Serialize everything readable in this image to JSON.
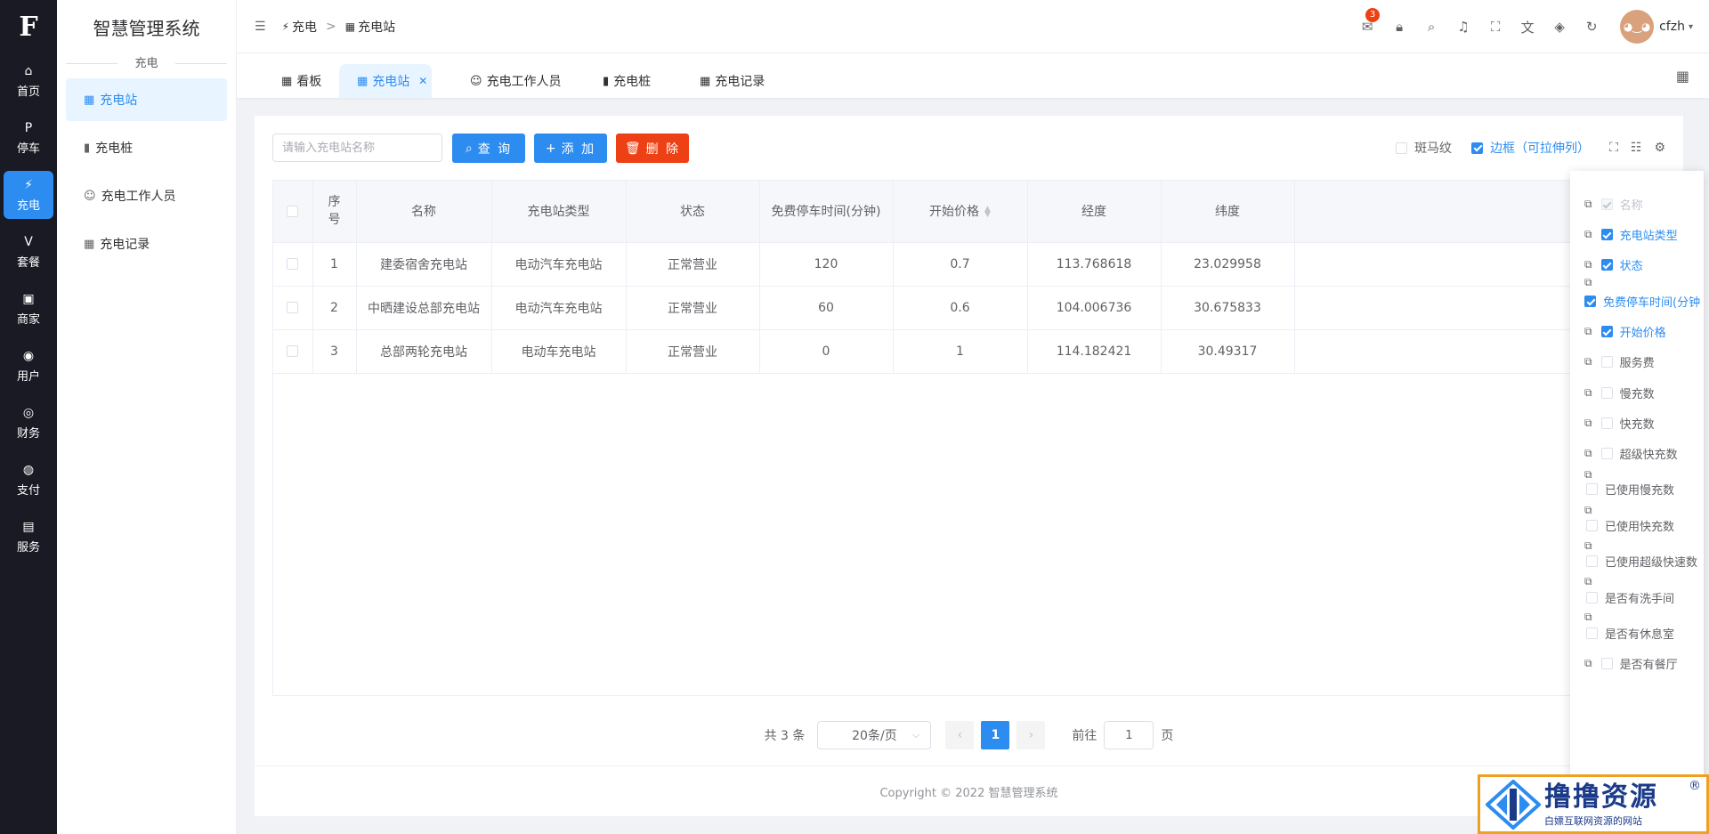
{
  "rail": {
    "logo": "F",
    "items": [
      {
        "label": "首页",
        "icon": "home-icon",
        "glyph": "⌂"
      },
      {
        "label": "停车",
        "icon": "parking-icon",
        "glyph": "P"
      },
      {
        "label": "充电",
        "icon": "charging-icon",
        "glyph": "⚡"
      },
      {
        "label": "套餐",
        "icon": "vip-icon",
        "glyph": "V"
      },
      {
        "label": "商家",
        "icon": "shop-icon",
        "glyph": "▣"
      },
      {
        "label": "用户",
        "icon": "user-icon",
        "glyph": "◉"
      },
      {
        "label": "财务",
        "icon": "finance-icon",
        "glyph": "◎"
      },
      {
        "label": "支付",
        "icon": "pay-icon",
        "glyph": "◍"
      },
      {
        "label": "服务",
        "icon": "service-icon",
        "glyph": "▤"
      }
    ],
    "active_index": 2
  },
  "sidebar": {
    "system_title": "智慧管理系统",
    "group_label": "充电",
    "items": [
      {
        "label": "充电站",
        "icon": "grid-icon",
        "glyph": "▦"
      },
      {
        "label": "充电桩",
        "icon": "charger-icon",
        "glyph": "▮"
      },
      {
        "label": "充电工作人员",
        "icon": "worker-icon",
        "glyph": "☺"
      },
      {
        "label": "充电记录",
        "icon": "grid-icon",
        "glyph": "▦"
      }
    ]
  },
  "header": {
    "breadcrumb": [
      "充电",
      "充电站"
    ],
    "breadcrumb_sep": ">",
    "notification_count": "3",
    "username": "cfzh",
    "tools": [
      "notification-icon",
      "lock-icon",
      "search-icon",
      "bell-icon",
      "fullscreen-icon",
      "translate-icon",
      "theme-icon",
      "refresh-icon"
    ]
  },
  "tabs": [
    {
      "label": "看板"
    },
    {
      "label": "充电站"
    },
    {
      "label": "充电工作人员"
    },
    {
      "label": "充电桩"
    },
    {
      "label": "充电记录"
    }
  ],
  "toolbar": {
    "search_placeholder": "请输入充电站名称",
    "query_label": "查 询",
    "add_label": "添 加",
    "delete_label": "删 除",
    "stripe_label": "斑马纹",
    "border_label": "边框（可拉伸列）"
  },
  "table": {
    "columns": [
      "序号",
      "名称",
      "充电站类型",
      "状态",
      "免费停车时间(分钟)",
      "开始价格",
      "经度",
      "纬度"
    ],
    "rows": [
      [
        "1",
        "建委宿舍充电站",
        "电动汽车充电站",
        "正常营业",
        "120",
        "0.7",
        "113.768618",
        "23.029958"
      ],
      [
        "2",
        "中晒建设总部充电站",
        "电动汽车充电站",
        "正常营业",
        "60",
        "0.6",
        "104.006736",
        "30.675833"
      ],
      [
        "3",
        "总部两轮充电站",
        "电动车充电站",
        "正常营业",
        "0",
        "1",
        "114.182421",
        "30.49317"
      ]
    ]
  },
  "pagination": {
    "total_text": "共 3 条",
    "page_size": "20条/页",
    "current_page": "1",
    "goto_label": "前往",
    "goto_value": "1",
    "page_suffix": "页"
  },
  "footer": "Copyright © 2022 智慧管理系统",
  "column_panel": {
    "items": [
      {
        "label": "名称",
        "state": "disabled"
      },
      {
        "label": "充电站类型",
        "state": "on"
      },
      {
        "label": "状态",
        "state": "on"
      },
      {
        "label": "免费停车时间(分钟",
        "state": "on"
      },
      {
        "label": "开始价格",
        "state": "on"
      },
      {
        "label": "服务费",
        "state": "off"
      },
      {
        "label": "慢充数",
        "state": "off"
      },
      {
        "label": "快充数",
        "state": "off"
      },
      {
        "label": "超级快充数",
        "state": "off"
      },
      {
        "label": "已使用慢充数",
        "state": "off"
      },
      {
        "label": "已使用快充数",
        "state": "off"
      },
      {
        "label": "已使用超级快速数",
        "state": "off"
      },
      {
        "label": "是否有洗手间",
        "state": "off"
      },
      {
        "label": "是否有休息室",
        "state": "off"
      },
      {
        "label": "是否有餐厅",
        "state": "off"
      }
    ]
  },
  "watermark": {
    "title": "撸撸资源",
    "subtitle": "白嫖互联网资源的网站",
    "reg": "®"
  },
  "colors": {
    "accent": "#2d8cf0",
    "danger": "#ed4014",
    "rail": "#191a23"
  }
}
